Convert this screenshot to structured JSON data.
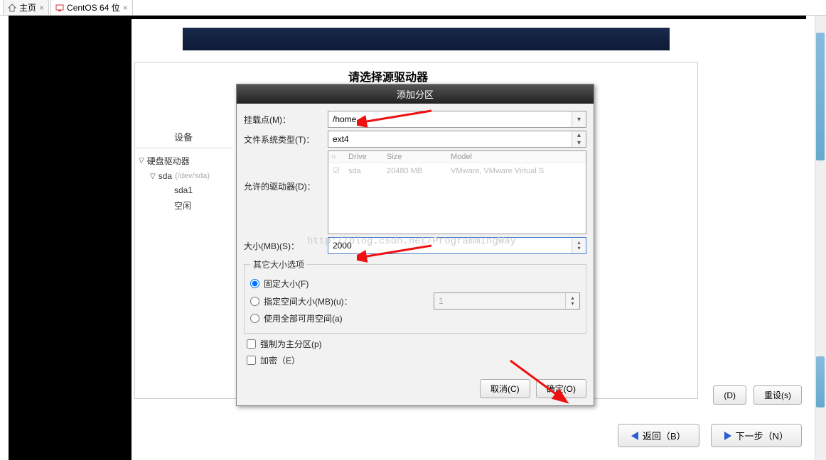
{
  "tabs": {
    "home": "主页",
    "vm": "CentOS 64 位"
  },
  "installer": {
    "section_title": "请选择源驱动器",
    "device_header": "设备",
    "tree": {
      "hdd": "硬盘驱动器",
      "sda": "sda",
      "sda_meta": "(/dev/sda)",
      "sda1": "sda1",
      "free": "空闲"
    }
  },
  "dialog": {
    "title": "添加分区",
    "mount_label": "挂载点(M)：",
    "mount_value": "/home",
    "fs_label": "文件系统类型(T)：",
    "fs_value": "ext4",
    "allowed_label": "允许的驱动器(D)：",
    "drive_head": {
      "drive": "Drive",
      "size": "Size",
      "model": "Model"
    },
    "drive_row": {
      "name": "sda",
      "size": "20480 MB",
      "model": "VMware, VMware Virtual S"
    },
    "size_label": "大小(MB)(S)：",
    "size_value": "2000",
    "other_legend": "其它大小选项",
    "radio_fixed": "固定大小(F)",
    "radio_fillup": "指定空间大小(MB)(u)：",
    "fillup_value": "1",
    "radio_all": "使用全部可用空间(a)",
    "force_primary": "强制为主分区(p)",
    "encrypt": "加密（E）",
    "cancel": "取消(C)",
    "ok": "确定(O)"
  },
  "bottom_buttons": {
    "d": "(D)",
    "reset": "重设(s)"
  },
  "nav": {
    "back": "返回（B）",
    "next": "下一步（N）"
  },
  "watermark": "http://blog.csdn.net/ProgrammingWay"
}
